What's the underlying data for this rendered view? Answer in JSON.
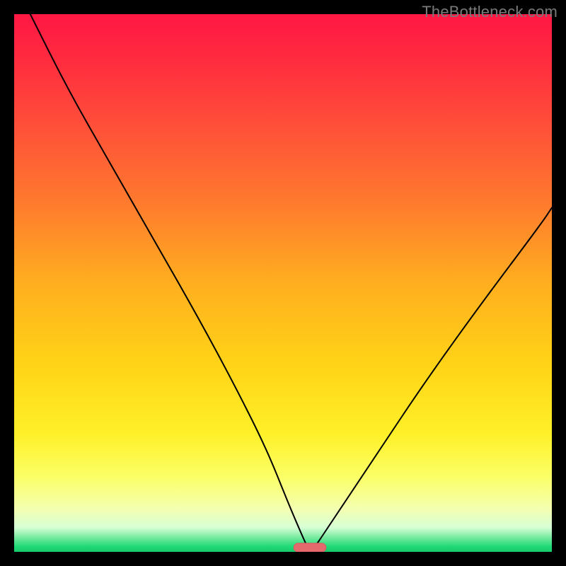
{
  "source_label": "TheBottleneck.com",
  "colors": {
    "frame": "#000000",
    "gradient_stops": [
      {
        "offset": 0.0,
        "color": "#ff1744"
      },
      {
        "offset": 0.08,
        "color": "#ff2a3f"
      },
      {
        "offset": 0.2,
        "color": "#ff4d3a"
      },
      {
        "offset": 0.35,
        "color": "#ff7a2e"
      },
      {
        "offset": 0.5,
        "color": "#ffae1f"
      },
      {
        "offset": 0.65,
        "color": "#ffd317"
      },
      {
        "offset": 0.78,
        "color": "#fff028"
      },
      {
        "offset": 0.86,
        "color": "#fbff66"
      },
      {
        "offset": 0.92,
        "color": "#f4ffb0"
      },
      {
        "offset": 0.955,
        "color": "#d6ffd6"
      },
      {
        "offset": 0.975,
        "color": "#6de89a"
      },
      {
        "offset": 0.99,
        "color": "#20d977"
      },
      {
        "offset": 1.0,
        "color": "#16c96a"
      }
    ],
    "curve": "#000000",
    "marker_fill": "#e46a6e",
    "marker_stroke": "#d85e62"
  },
  "chart_data": {
    "type": "line",
    "title": "",
    "xlabel": "",
    "ylabel": "",
    "xlim": [
      0,
      100
    ],
    "ylim": [
      0,
      100
    ],
    "legend": false,
    "grid": false,
    "optimum_x": 55,
    "marker": {
      "x_center": 55,
      "width": 6,
      "height": 1.6,
      "y": 0.8
    },
    "series": [
      {
        "name": "bottleneck-curve",
        "x": [
          3,
          10,
          18,
          26,
          34,
          41,
          47,
          51,
          54,
          55,
          56,
          58,
          62,
          68,
          76,
          86,
          98,
          100
        ],
        "y": [
          100,
          86,
          72,
          58,
          44,
          31,
          19,
          9,
          2,
          0,
          1,
          4,
          10,
          19,
          31,
          45,
          61,
          64
        ]
      }
    ]
  }
}
